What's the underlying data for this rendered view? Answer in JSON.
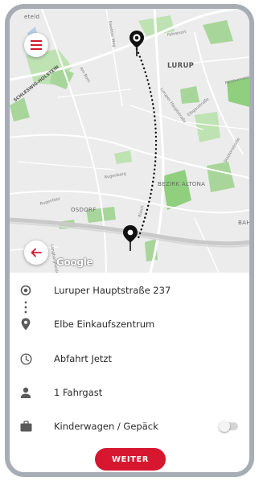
{
  "map": {
    "labels": {
      "lurup": "LURUP",
      "bezirk_altona": "BEZIRK ALTONA",
      "osdorf": "OSDORF",
      "bahr": "BAHR",
      "schleswig": "SCHLESWIG-HOLSTEIN",
      "ottensen": "eteld",
      "rugenbarg": "Rugenbarg",
      "luruper_hauptstrasse": "Luruper Hauptstraße",
      "ellerbrook": "Elbgaustraße",
      "fahrenort": "Fahrenort",
      "schenefelder": "Swebter Weg",
      "am_born": "Am Born",
      "rugenfeld": "Rugenfeld",
      "stadionstrasse": "Stadionstraße",
      "farnhornweg": "Farnhornweg",
      "langenfelde": "Langbargheide",
      "ruesch": "Rüsch"
    },
    "attribution": "Google",
    "menu_icon": "hamburger-menu-icon",
    "back_icon": "arrow-left-icon"
  },
  "trip": {
    "origin": "Luruper Hauptstraße 237",
    "destination": "Elbe Einkaufszentrum",
    "departure": "Abfahrt Jetzt",
    "passengers": "1 Fahrgast",
    "luggage": "Kinderwagen / Gepäck",
    "luggage_enabled": false
  },
  "actions": {
    "continue_label": "WEITER"
  },
  "colors": {
    "brand_red": "#d7172f",
    "map_bg": "#ececec",
    "park_green": "#a8d69a",
    "frame": "#a7adb4"
  }
}
